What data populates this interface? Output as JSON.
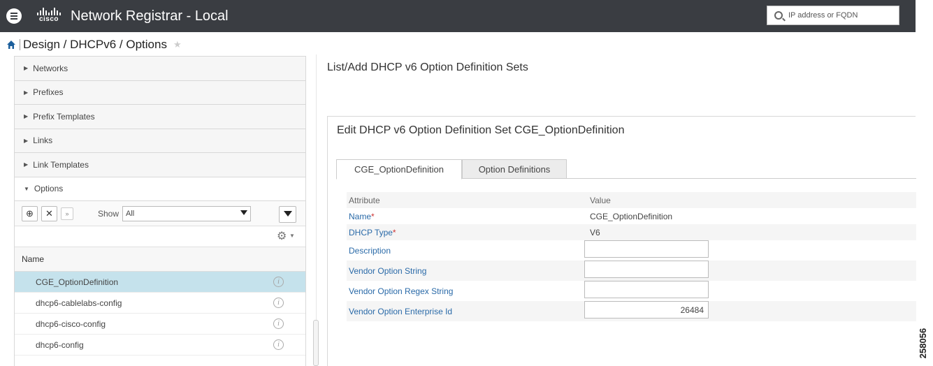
{
  "header": {
    "app_title": "Network Registrar - Local",
    "logo_word": "cisco",
    "search_placeholder": "IP address or FQDN"
  },
  "breadcrumb": {
    "text": "Design / DHCPv6 / Options"
  },
  "sidebar": {
    "items": [
      {
        "label": "Networks"
      },
      {
        "label": "Prefixes"
      },
      {
        "label": "Prefix Templates"
      },
      {
        "label": "Links"
      },
      {
        "label": "Link Templates"
      },
      {
        "label": "Options"
      }
    ],
    "toolbar": {
      "show_label": "Show",
      "show_value": "All"
    },
    "list_header": "Name",
    "list": [
      {
        "name": "CGE_OptionDefinition",
        "selected": true
      },
      {
        "name": "dhcp6-cablelabs-config",
        "selected": false
      },
      {
        "name": "dhcp6-cisco-config",
        "selected": false
      },
      {
        "name": "dhcp6-config",
        "selected": false
      }
    ]
  },
  "main": {
    "list_title": "List/Add DHCP v6 Option Definition Sets",
    "edit_title": "Edit DHCP v6 Option Definition Set CGE_OptionDefinition",
    "tabs": [
      {
        "label": "CGE_OptionDefinition",
        "active": true
      },
      {
        "label": "Option Definitions",
        "active": false
      }
    ],
    "table_header": {
      "attribute": "Attribute",
      "value": "Value"
    },
    "attributes": [
      {
        "label": "Name",
        "required": "*",
        "value": "CGE_OptionDefinition"
      },
      {
        "label": "DHCP Type",
        "required": "*",
        "value": "V6"
      },
      {
        "label": "Description",
        "value": ""
      },
      {
        "label": "Vendor Option String",
        "value": ""
      },
      {
        "label": "Vendor Option Regex String",
        "value": ""
      },
      {
        "label": "Vendor Option Enterprise Id",
        "value": "26484"
      }
    ]
  },
  "figure_number": "258056",
  "colors": {
    "topbar": "#3a3d42",
    "selected_row": "#c5e2ec",
    "link_blue": "#2a6aa8",
    "required_red": "#cc3333"
  },
  "icons": [
    "menu-icon",
    "cisco-logo",
    "search-icon",
    "home-icon",
    "star-icon",
    "add-icon",
    "delete-icon",
    "expand-icon",
    "filter-icon",
    "gear-icon",
    "info-icon"
  ]
}
